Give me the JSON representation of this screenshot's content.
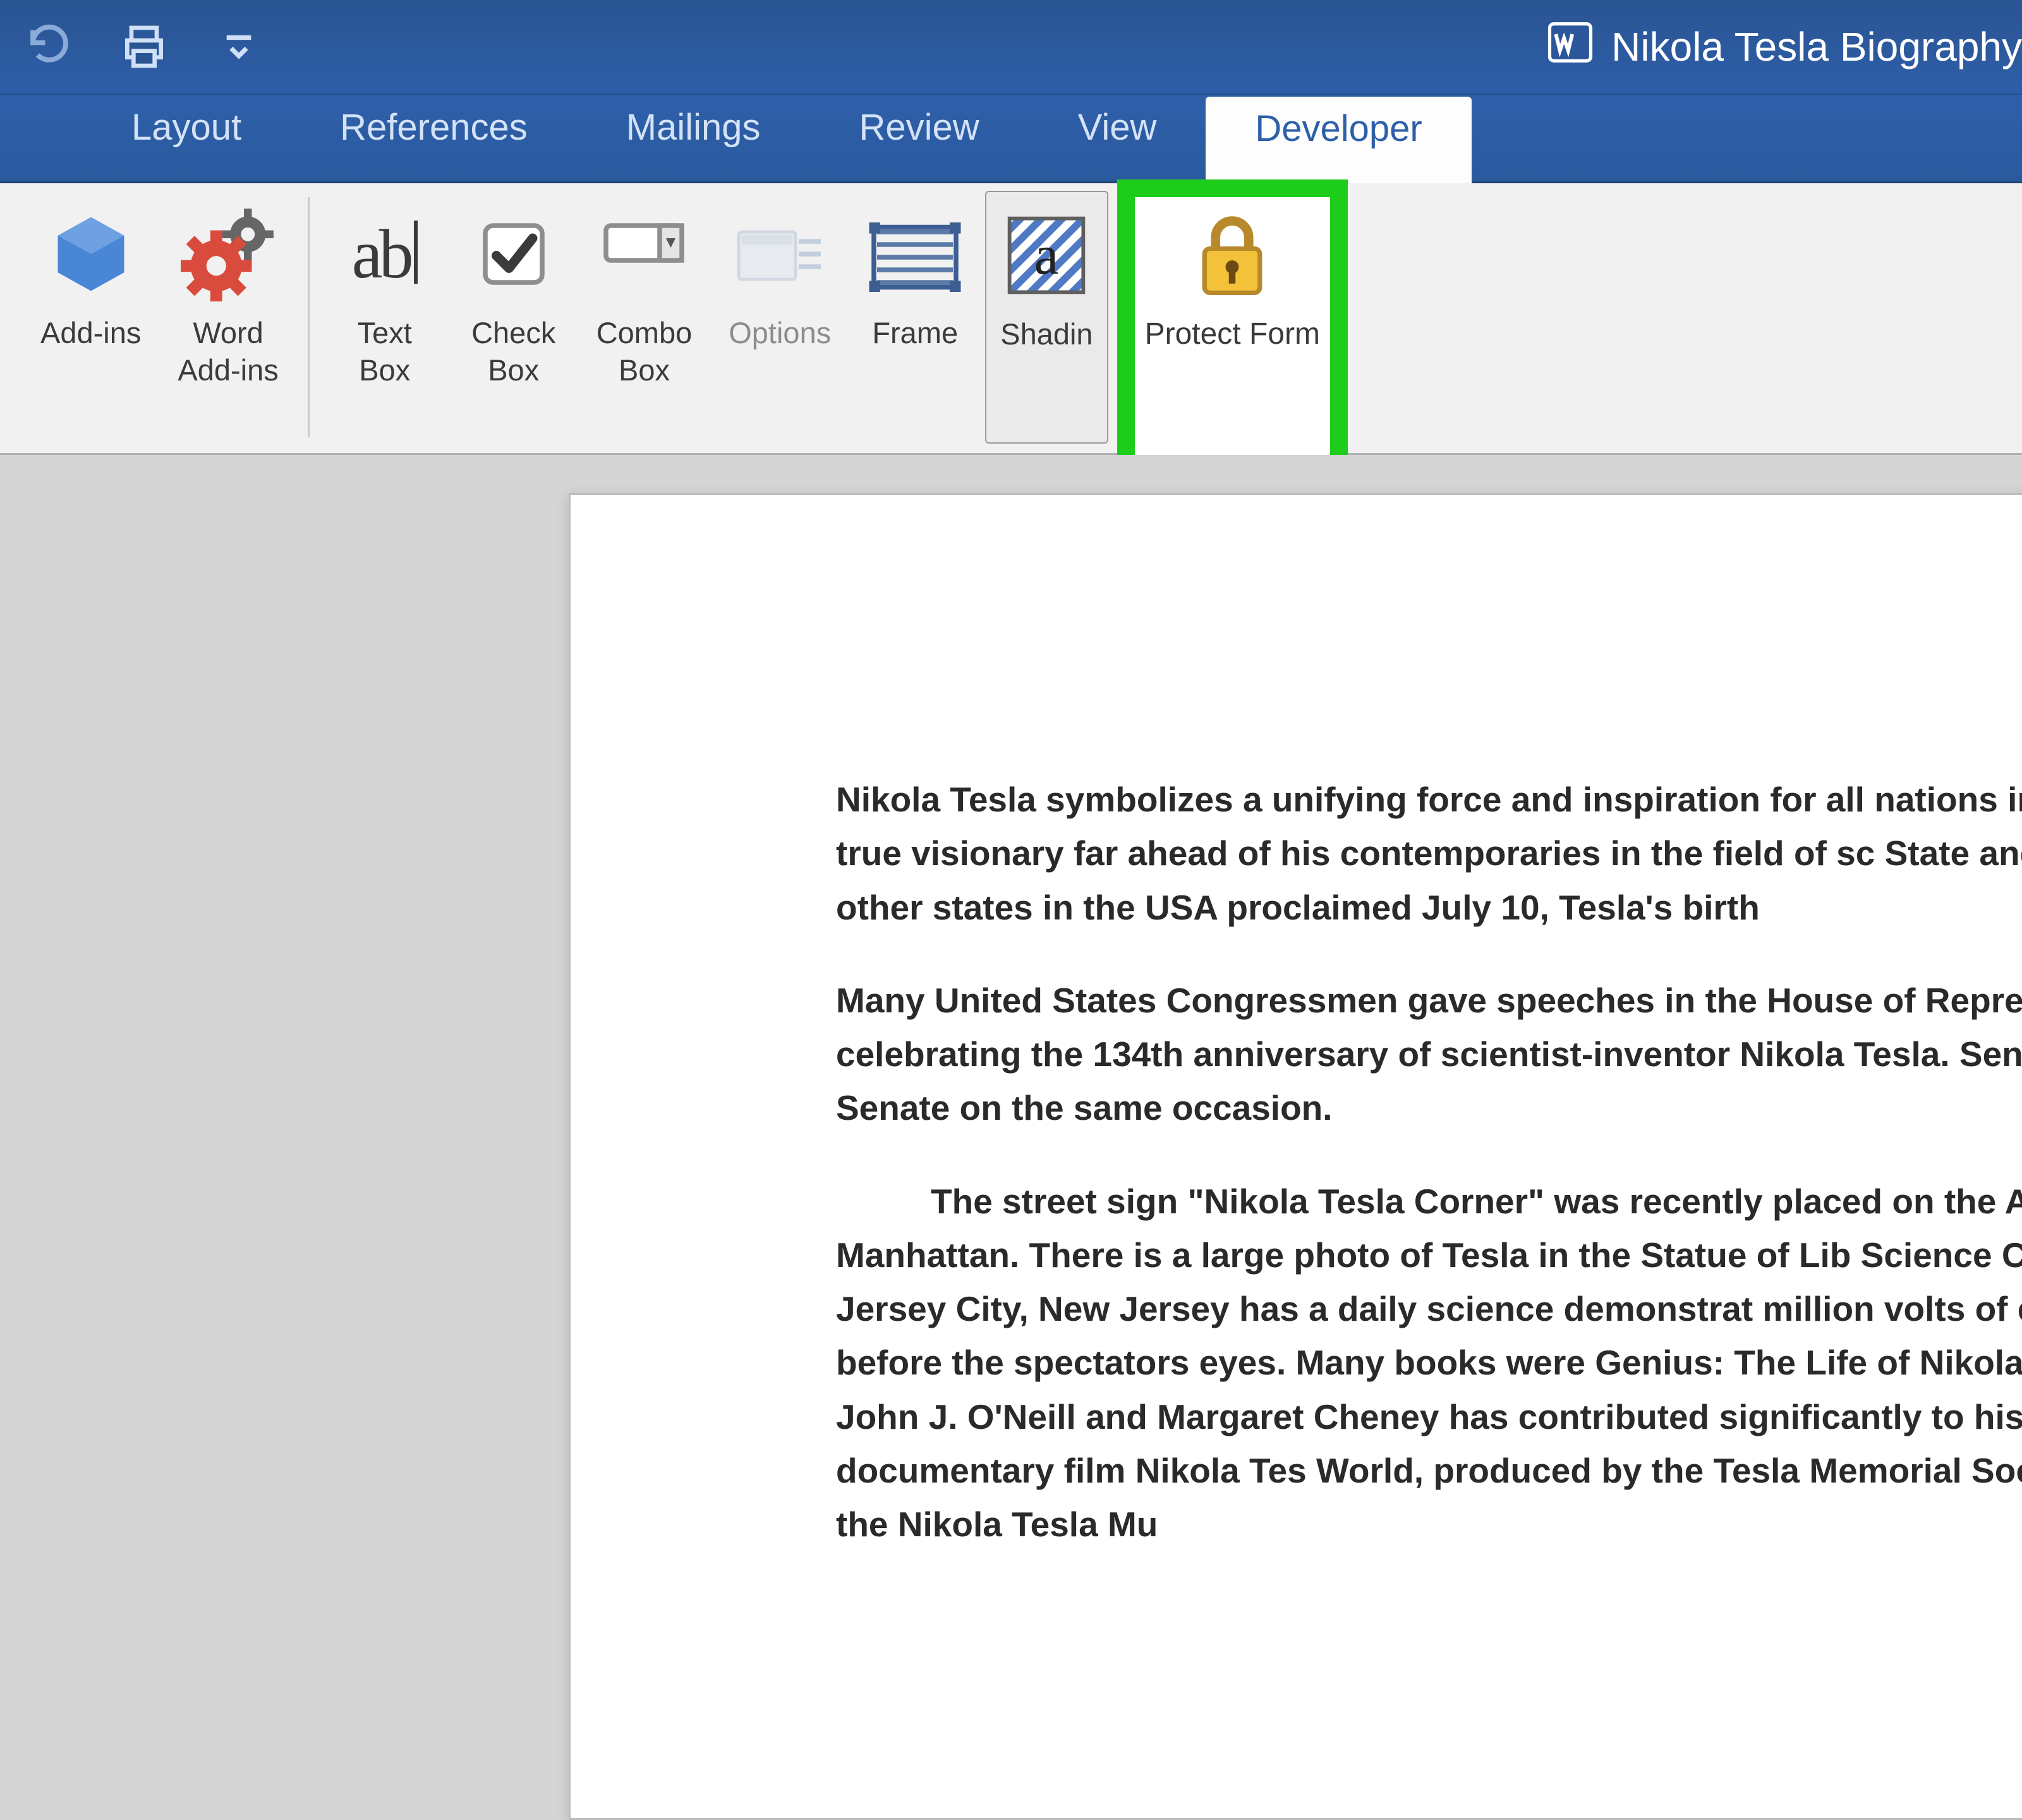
{
  "title_bar": {
    "doc_name": "Nikola Tesla Biography"
  },
  "tabs": {
    "layout": "Layout",
    "references": "References",
    "mailings": "Mailings",
    "review": "Review",
    "view": "View",
    "developer": "Developer"
  },
  "ribbon": {
    "addins": "Add-ins",
    "word_addins": "Word\nAdd-ins",
    "text_box": "Text\nBox",
    "check_box": "Check\nBox",
    "combo_box": "Combo\nBox",
    "options": "Options",
    "frame": "Frame",
    "shading": "Shadin",
    "protect_form": "Protect\nForm"
  },
  "document": {
    "p1": "Nikola Tesla symbolizes a unifying force and inspiration for all nations in He was a true visionary far ahead of his contemporaries in the field of sc State and many other states in the USA proclaimed July 10, Tesla's birth",
    "p2": "Many United States Congressmen gave speeches in the House of Repres celebrating the 134th anniversary of scientist-inventor Nikola Tesla. Sen in the US Senate on the same occasion.",
    "p3": "The street sign \"Nikola Tesla Corner\" was recently placed on the Avenue in Manhattan. There is a large photo of Tesla in the Statue of Lib Science Center in Jersey City, New Jersey has a daily science demonstrat million volts of electricity before the spectators eyes. Many books were Genius: The Life of Nikola Tesla by John J. O'Neill  and Margaret Cheney has contributed significantly to his fame. A documentary film Nikola Tes World, produced by the Tesla Memorial Society and the Nikola Tesla Mu"
  }
}
